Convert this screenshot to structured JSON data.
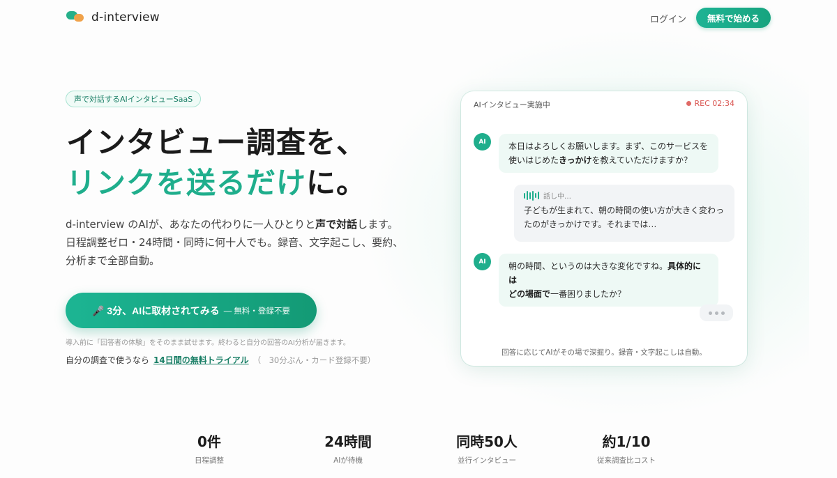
{
  "header": {
    "logo_text": "d-interview",
    "login_label": "ログイン",
    "start_label": "無料で始める"
  },
  "hero": {
    "badge": "声で対話するAIインタビューSaaS",
    "title_line1": "インタビュー調査を、",
    "title_line2_accent": "リンクを送るだけ",
    "title_line2_rest": "に。",
    "desc_part1": "d-interview のAIが、あなたの代わりに一人ひとりと",
    "desc_bold": "声で対話",
    "desc_part2": "します。 日程調整ゼロ・24時間・同時に何十人でも。録音、文字起こし、要約、分析まで全部自動。",
    "cta_main": "🎤 3分、AIに取材されてみる",
    "cta_sub": "— 無料・登録不要",
    "note1": "導入前に「回答者の体験」をそのまま試せます。終わると自分の回答のAI分析が届きます。",
    "note2_prefix": "自分の調査で使うなら",
    "trial_link": "14日間の無料トライアル",
    "trial_meta": "（　30分ぶん・カード登録不要）"
  },
  "chat": {
    "title": "AIインタビュー実施中",
    "rec": "REC 02:34",
    "avatar_label": "AI",
    "msg1_line1": "本日はよろしくお願いします。まず、このサービスを",
    "msg1_line2_pre": "使いはじめた",
    "msg1_line2_bold": "きっかけ",
    "msg1_line2_post": "を教えていただけますか？",
    "speaking_label": "話し中…",
    "user_line1": "子どもが生まれて、朝の時間の使い方が大きく変わっ",
    "user_line2": "たのがきっかけです。それまでは…",
    "msg2_line1_pre": "朝の時間、というのは大きな変化ですね。",
    "msg2_line1_bold": "具体的には",
    "msg2_line2_bold": "どの場面で",
    "msg2_line2_post": "一番困りましたか？",
    "footer": "回答に応じてAIがその場で深掘り。録音・文字起こしは自動。"
  },
  "stats": [
    {
      "value": "0件",
      "label": "日程調整"
    },
    {
      "value": "24時間",
      "label": "AIが待機"
    },
    {
      "value": "同時50人",
      "label": "並行インタビュー"
    },
    {
      "value": "約1/10",
      "label": "従来調査比コスト"
    }
  ],
  "colors": {
    "accent": "#1fae8c",
    "rec": "#d9534f"
  }
}
